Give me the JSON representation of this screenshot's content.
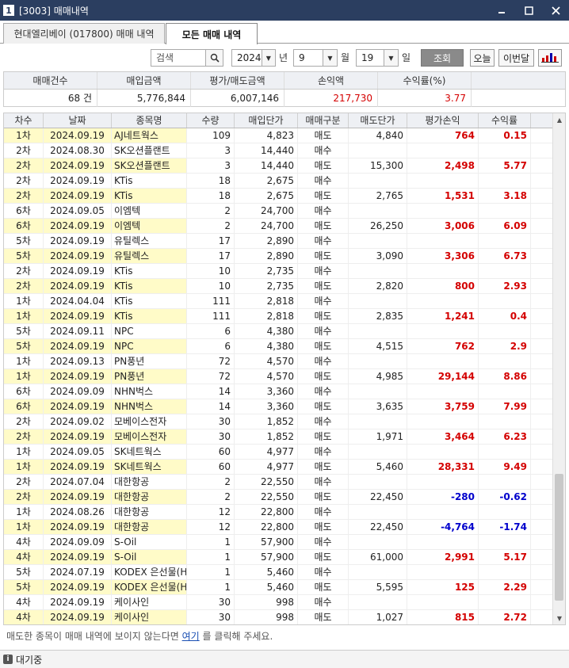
{
  "window": {
    "icon_label": "1",
    "title": "[3003] 매매내역",
    "icons": [
      "window-icon",
      "minimize-icon",
      "maximize-icon",
      "close-icon"
    ]
  },
  "tabs": [
    {
      "label": "현대엘리베이 (017800) 매매 내역"
    },
    {
      "label": "모든 매매 내역"
    }
  ],
  "toolbar": {
    "search_placeholder": "검색",
    "year": "2024",
    "year_unit": "년",
    "month": "9",
    "month_unit": "월",
    "day": "19",
    "day_unit": "일",
    "query_button": "조회",
    "today_button": "오늘",
    "this_month_button": "이번달"
  },
  "summary": {
    "headers": [
      "매매건수",
      "매입금액",
      "평가/매도금액",
      "손익액",
      "수익률(%)"
    ],
    "trade_count": "68 건",
    "buy_amount": "5,776,844",
    "eval_amount": "6,007,146",
    "profit": "217,730",
    "rate": "3.77"
  },
  "grid": {
    "headers": [
      "차수",
      "날짜",
      "종목명",
      "수량",
      "매입단가",
      "매매구분",
      "매도단가",
      "평가손익",
      "수익률"
    ],
    "rows": [
      {
        "cha": "1차",
        "date": "2024.09.19",
        "name": "AJ네트웍스",
        "qty": "109",
        "bprice": "4,823",
        "type": "매도",
        "sprice": "4,840",
        "pl": "764",
        "rate": "0.15",
        "sign": "pos"
      },
      {
        "cha": "2차",
        "date": "2024.08.30",
        "name": "SK오션플랜트",
        "qty": "3",
        "bprice": "14,440",
        "type": "매수",
        "sprice": "",
        "pl": "",
        "rate": "",
        "sign": ""
      },
      {
        "cha": "2차",
        "date": "2024.09.19",
        "name": "SK오션플랜트",
        "qty": "3",
        "bprice": "14,440",
        "type": "매도",
        "sprice": "15,300",
        "pl": "2,498",
        "rate": "5.77",
        "sign": "pos"
      },
      {
        "cha": "2차",
        "date": "2024.09.19",
        "name": "KTis",
        "qty": "18",
        "bprice": "2,675",
        "type": "매수",
        "sprice": "",
        "pl": "",
        "rate": "",
        "sign": ""
      },
      {
        "cha": "2차",
        "date": "2024.09.19",
        "name": "KTis",
        "qty": "18",
        "bprice": "2,675",
        "type": "매도",
        "sprice": "2,765",
        "pl": "1,531",
        "rate": "3.18",
        "sign": "pos"
      },
      {
        "cha": "6차",
        "date": "2024.09.05",
        "name": "이엠텍",
        "qty": "2",
        "bprice": "24,700",
        "type": "매수",
        "sprice": "",
        "pl": "",
        "rate": "",
        "sign": ""
      },
      {
        "cha": "6차",
        "date": "2024.09.19",
        "name": "이엠텍",
        "qty": "2",
        "bprice": "24,700",
        "type": "매도",
        "sprice": "26,250",
        "pl": "3,006",
        "rate": "6.09",
        "sign": "pos"
      },
      {
        "cha": "5차",
        "date": "2024.09.19",
        "name": "유틸렉스",
        "qty": "17",
        "bprice": "2,890",
        "type": "매수",
        "sprice": "",
        "pl": "",
        "rate": "",
        "sign": ""
      },
      {
        "cha": "5차",
        "date": "2024.09.19",
        "name": "유틸렉스",
        "qty": "17",
        "bprice": "2,890",
        "type": "매도",
        "sprice": "3,090",
        "pl": "3,306",
        "rate": "6.73",
        "sign": "pos"
      },
      {
        "cha": "2차",
        "date": "2024.09.19",
        "name": "KTis",
        "qty": "10",
        "bprice": "2,735",
        "type": "매수",
        "sprice": "",
        "pl": "",
        "rate": "",
        "sign": ""
      },
      {
        "cha": "2차",
        "date": "2024.09.19",
        "name": "KTis",
        "qty": "10",
        "bprice": "2,735",
        "type": "매도",
        "sprice": "2,820",
        "pl": "800",
        "rate": "2.93",
        "sign": "pos"
      },
      {
        "cha": "1차",
        "date": "2024.04.04",
        "name": "KTis",
        "qty": "111",
        "bprice": "2,818",
        "type": "매수",
        "sprice": "",
        "pl": "",
        "rate": "",
        "sign": ""
      },
      {
        "cha": "1차",
        "date": "2024.09.19",
        "name": "KTis",
        "qty": "111",
        "bprice": "2,818",
        "type": "매도",
        "sprice": "2,835",
        "pl": "1,241",
        "rate": "0.4",
        "sign": "pos"
      },
      {
        "cha": "5차",
        "date": "2024.09.11",
        "name": "NPC",
        "qty": "6",
        "bprice": "4,380",
        "type": "매수",
        "sprice": "",
        "pl": "",
        "rate": "",
        "sign": ""
      },
      {
        "cha": "5차",
        "date": "2024.09.19",
        "name": "NPC",
        "qty": "6",
        "bprice": "4,380",
        "type": "매도",
        "sprice": "4,515",
        "pl": "762",
        "rate": "2.9",
        "sign": "pos"
      },
      {
        "cha": "1차",
        "date": "2024.09.13",
        "name": "PN풍년",
        "qty": "72",
        "bprice": "4,570",
        "type": "매수",
        "sprice": "",
        "pl": "",
        "rate": "",
        "sign": ""
      },
      {
        "cha": "1차",
        "date": "2024.09.19",
        "name": "PN풍년",
        "qty": "72",
        "bprice": "4,570",
        "type": "매도",
        "sprice": "4,985",
        "pl": "29,144",
        "rate": "8.86",
        "sign": "pos"
      },
      {
        "cha": "6차",
        "date": "2024.09.09",
        "name": "NHN벅스",
        "qty": "14",
        "bprice": "3,360",
        "type": "매수",
        "sprice": "",
        "pl": "",
        "rate": "",
        "sign": ""
      },
      {
        "cha": "6차",
        "date": "2024.09.19",
        "name": "NHN벅스",
        "qty": "14",
        "bprice": "3,360",
        "type": "매도",
        "sprice": "3,635",
        "pl": "3,759",
        "rate": "7.99",
        "sign": "pos"
      },
      {
        "cha": "2차",
        "date": "2024.09.02",
        "name": "모베이스전자",
        "qty": "30",
        "bprice": "1,852",
        "type": "매수",
        "sprice": "",
        "pl": "",
        "rate": "",
        "sign": ""
      },
      {
        "cha": "2차",
        "date": "2024.09.19",
        "name": "모베이스전자",
        "qty": "30",
        "bprice": "1,852",
        "type": "매도",
        "sprice": "1,971",
        "pl": "3,464",
        "rate": "6.23",
        "sign": "pos"
      },
      {
        "cha": "1차",
        "date": "2024.09.05",
        "name": "SK네트웍스",
        "qty": "60",
        "bprice": "4,977",
        "type": "매수",
        "sprice": "",
        "pl": "",
        "rate": "",
        "sign": ""
      },
      {
        "cha": "1차",
        "date": "2024.09.19",
        "name": "SK네트웍스",
        "qty": "60",
        "bprice": "4,977",
        "type": "매도",
        "sprice": "5,460",
        "pl": "28,331",
        "rate": "9.49",
        "sign": "pos"
      },
      {
        "cha": "2차",
        "date": "2024.07.04",
        "name": "대한항공",
        "qty": "2",
        "bprice": "22,550",
        "type": "매수",
        "sprice": "",
        "pl": "",
        "rate": "",
        "sign": ""
      },
      {
        "cha": "2차",
        "date": "2024.09.19",
        "name": "대한항공",
        "qty": "2",
        "bprice": "22,550",
        "type": "매도",
        "sprice": "22,450",
        "pl": "-280",
        "rate": "-0.62",
        "sign": "neg"
      },
      {
        "cha": "1차",
        "date": "2024.08.26",
        "name": "대한항공",
        "qty": "12",
        "bprice": "22,800",
        "type": "매수",
        "sprice": "",
        "pl": "",
        "rate": "",
        "sign": ""
      },
      {
        "cha": "1차",
        "date": "2024.09.19",
        "name": "대한항공",
        "qty": "12",
        "bprice": "22,800",
        "type": "매도",
        "sprice": "22,450",
        "pl": "-4,764",
        "rate": "-1.74",
        "sign": "neg"
      },
      {
        "cha": "4차",
        "date": "2024.09.09",
        "name": "S-Oil",
        "qty": "1",
        "bprice": "57,900",
        "type": "매수",
        "sprice": "",
        "pl": "",
        "rate": "",
        "sign": ""
      },
      {
        "cha": "4차",
        "date": "2024.09.19",
        "name": "S-Oil",
        "qty": "1",
        "bprice": "57,900",
        "type": "매도",
        "sprice": "61,000",
        "pl": "2,991",
        "rate": "5.17",
        "sign": "pos"
      },
      {
        "cha": "5차",
        "date": "2024.07.19",
        "name": "KODEX 은선물(H)",
        "qty": "1",
        "bprice": "5,460",
        "type": "매수",
        "sprice": "",
        "pl": "",
        "rate": "",
        "sign": ""
      },
      {
        "cha": "5차",
        "date": "2024.09.19",
        "name": "KODEX 은선물(H)",
        "qty": "1",
        "bprice": "5,460",
        "type": "매도",
        "sprice": "5,595",
        "pl": "125",
        "rate": "2.29",
        "sign": "pos"
      },
      {
        "cha": "4차",
        "date": "2024.09.19",
        "name": "케이사인",
        "qty": "30",
        "bprice": "998",
        "type": "매수",
        "sprice": "",
        "pl": "",
        "rate": "",
        "sign": ""
      },
      {
        "cha": "4차",
        "date": "2024.09.19",
        "name": "케이사인",
        "qty": "30",
        "bprice": "998",
        "type": "매도",
        "sprice": "1,027",
        "pl": "815",
        "rate": "2.72",
        "sign": "pos"
      }
    ]
  },
  "notice": {
    "before": "매도한 종목이 매매 내역에 보이지 않는다면",
    "link": "여기",
    "after": "를 클릭해 주세요."
  },
  "status": {
    "text": "대기중"
  },
  "colors": {
    "titlebar": "#2b3e60",
    "profit": "#d40000",
    "loss": "#0000cc",
    "sell_highlight": "#fffbc8"
  }
}
